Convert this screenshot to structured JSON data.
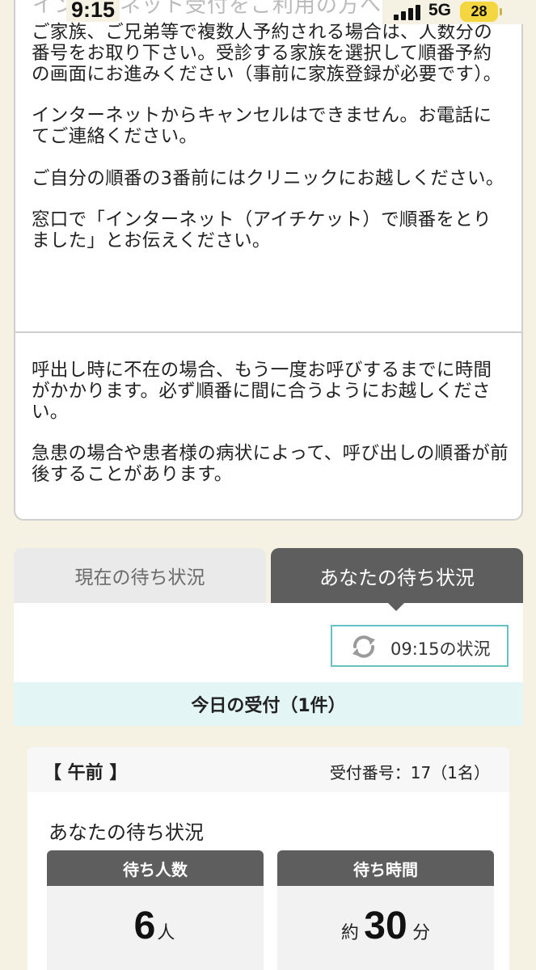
{
  "status_bar": {
    "time": "9:15",
    "network": "5G",
    "battery": "28",
    "cutoff_title": "インターネット受付をご利用の方へ"
  },
  "notice": {
    "section1": [
      "ご家族、ご兄弟等で複数人予約される場合は、人数分の番号をお取り下さい。受診する家族を選択して順番予約の画面にお進みください（事前に家族登録が必要です）。",
      "インターネットからキャンセルはできません。お電話にてご連絡ください。",
      "ご自分の順番の3番前にはクリニックにお越しください。",
      "窓口で「インターネット（アイチケット）で順番をとりました」とお伝えください。"
    ],
    "section2": [
      "呼出し時に不在の場合、もう一度お呼びするまでに時間がかかります。必ず順番に間に合うようにお越しください。",
      "急患の場合や患者様の病状によって、呼び出しの順番が前後することがあります。"
    ]
  },
  "tabs": {
    "current": "現在の待ち状況",
    "yours": "あなたの待ち状況"
  },
  "refresh": {
    "label": "09:15の状況",
    "icon": "refresh-icon"
  },
  "today": {
    "label": "今日の受付（1件）"
  },
  "reception": {
    "period": "【 午前 】",
    "number_text": "受付番号：17（1名）",
    "title": "あなたの待ち状況",
    "people": {
      "label": "待ち人数",
      "value": "6",
      "unit": "人"
    },
    "time": {
      "label": "待ち時間",
      "prefix": "約",
      "value": "30",
      "unit": "分"
    }
  },
  "colors": {
    "accent_teal": "#67c1c4",
    "tab_active": "#5e5e5e",
    "background": "#f6f2e3",
    "today_bar": "#e3f6f5"
  }
}
